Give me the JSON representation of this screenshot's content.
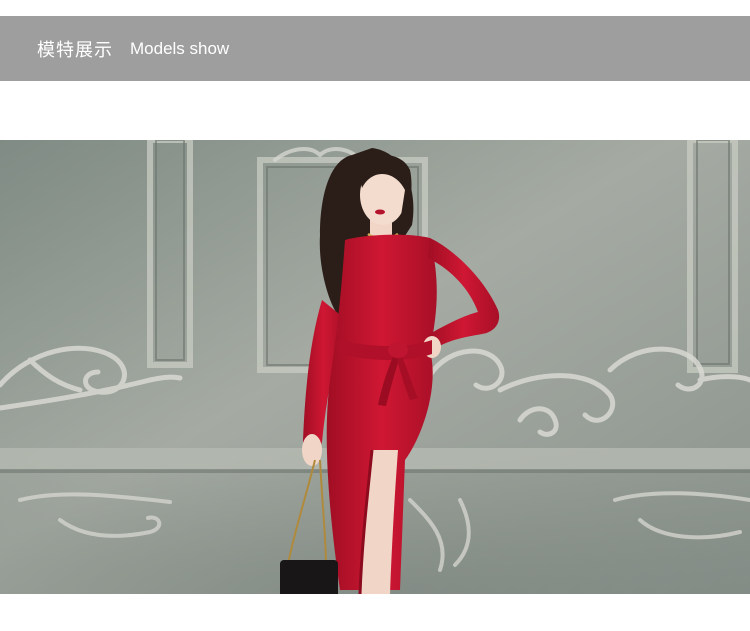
{
  "header": {
    "title_cn": "模特展示",
    "title_en": "Models show"
  },
  "photo": {
    "subject": "model-in-red-dress",
    "colors": {
      "wall": "#8c968f",
      "dress": "#c8102e",
      "hair": "#2b1d18",
      "skin": "#f1d6c8"
    }
  },
  "colors": {
    "header_bg": "#9e9e9e",
    "header_text": "#ffffff"
  }
}
